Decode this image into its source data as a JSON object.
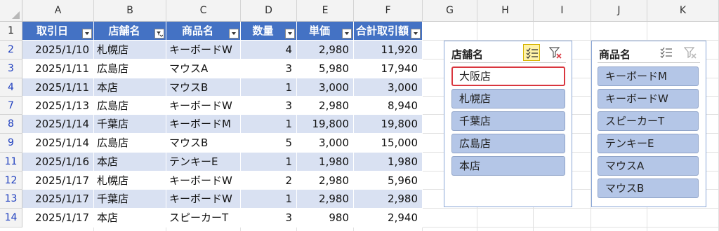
{
  "columns": [
    "A",
    "B",
    "C",
    "D",
    "E",
    "F",
    "G",
    "H",
    "I",
    "J",
    "K"
  ],
  "row_numbers": [
    "1",
    "2",
    "3",
    "4",
    "7",
    "8",
    "9",
    "11",
    "12",
    "13",
    "14"
  ],
  "table": {
    "headers": [
      "取引日",
      "店舗名",
      "商品名",
      "数量",
      "単価",
      "合計取引額"
    ],
    "rows": [
      [
        "2025/1/10",
        "札幌店",
        "キーボードW",
        "4",
        "2,980",
        "11,920"
      ],
      [
        "2025/1/11",
        "広島店",
        "マウスA",
        "3",
        "5,980",
        "17,940"
      ],
      [
        "2025/1/11",
        "本店",
        "マウスB",
        "1",
        "3,000",
        "3,000"
      ],
      [
        "2025/1/13",
        "広島店",
        "キーボードW",
        "3",
        "2,980",
        "8,940"
      ],
      [
        "2025/1/14",
        "千葉店",
        "キーボードM",
        "1",
        "19,800",
        "19,800"
      ],
      [
        "2025/1/14",
        "広島店",
        "マウスB",
        "5",
        "3,000",
        "15,000"
      ],
      [
        "2025/1/16",
        "本店",
        "テンキーE",
        "1",
        "1,980",
        "1,980"
      ],
      [
        "2025/1/17",
        "札幌店",
        "キーボードW",
        "2",
        "2,980",
        "5,960"
      ],
      [
        "2025/1/17",
        "千葉店",
        "キーボードW",
        "1",
        "2,980",
        "2,980"
      ],
      [
        "2025/1/17",
        "本店",
        "スピーカーT",
        "3",
        "980",
        "2,940"
      ]
    ]
  },
  "slicer_store": {
    "title": "店舗名",
    "multiselect_active": true,
    "items": [
      "大阪店",
      "札幌店",
      "千葉店",
      "広島店",
      "本店"
    ],
    "selected_item": "大阪店"
  },
  "slicer_product": {
    "title": "商品名",
    "multiselect_active": false,
    "items": [
      "キーボードM",
      "キーボードW",
      "スピーカーT",
      "テンキーE",
      "マウスA",
      "マウスB"
    ]
  },
  "colors": {
    "table_header": "#4472c4",
    "band": "#d9e1f2",
    "slicer_item": "#b4c6e7",
    "selected_outline": "#d9363e",
    "filtered_row_number": "#1f3fbf"
  }
}
